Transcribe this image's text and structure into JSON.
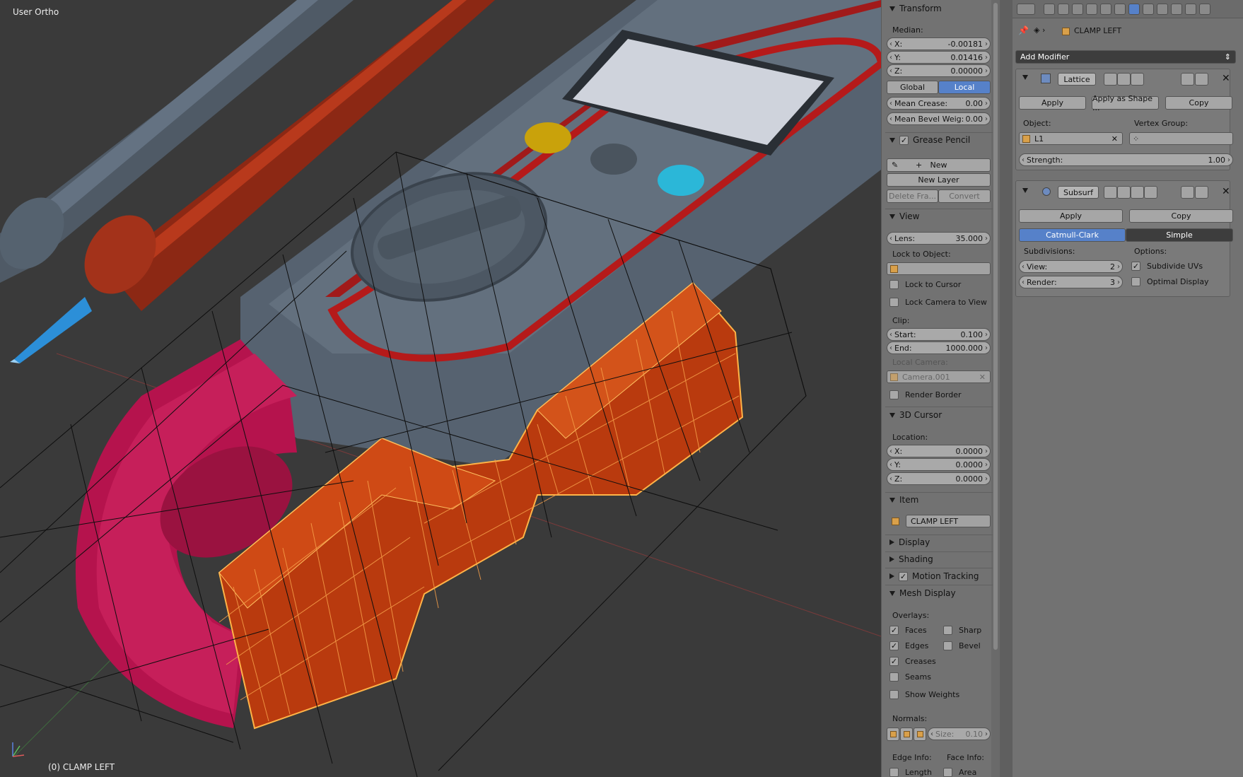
{
  "viewport": {
    "title": "User Ortho",
    "object_label": "(0) CLAMP LEFT"
  },
  "transform": {
    "header": "Transform",
    "median_label": "Median:",
    "x_label": "X:",
    "x": "-0.00181",
    "y_label": "Y:",
    "y": "0.01416",
    "z_label": "Z:",
    "z": "0.00000",
    "global": "Global",
    "local": "Local",
    "mean_crease_label": "Mean Crease:",
    "mean_crease": "0.00",
    "mean_bevel_label": "Mean Bevel Weig:",
    "mean_bevel": "0.00"
  },
  "grease_pencil": {
    "header": "Grease Pencil",
    "new": "New",
    "new_layer": "New Layer",
    "delete_frame": "Delete Fra...",
    "convert": "Convert"
  },
  "view": {
    "header": "View",
    "lens_label": "Lens:",
    "lens": "35.000",
    "lock_to_object": "Lock to Object:",
    "lock_to_cursor": "Lock to Cursor",
    "lock_camera": "Lock Camera to View",
    "clip": "Clip:",
    "start_label": "Start:",
    "start": "0.100",
    "end_label": "End:",
    "end": "1000.000",
    "local_camera": "Local Camera:",
    "camera_value": "Camera.001",
    "render_border": "Render Border"
  },
  "cursor": {
    "header": "3D Cursor",
    "location": "Location:",
    "x_label": "X:",
    "x": "0.0000",
    "y_label": "Y:",
    "y": "0.0000",
    "z_label": "Z:",
    "z": "0.0000"
  },
  "item": {
    "header": "Item",
    "name": "CLAMP LEFT"
  },
  "collapsed": {
    "display": "Display",
    "shading": "Shading",
    "motion_tracking": "Motion Tracking"
  },
  "mesh_display": {
    "header": "Mesh Display",
    "overlays": "Overlays:",
    "faces": "Faces",
    "sharp": "Sharp",
    "edges": "Edges",
    "bevel": "Bevel",
    "creases": "Creases",
    "seams": "Seams",
    "show_weights": "Show Weights",
    "normals": "Normals:",
    "size_label": "Size:",
    "size": "0.10",
    "edge_info": "Edge Info:",
    "face_info": "Face Info:",
    "length": "Length",
    "area": "Area"
  },
  "props": {
    "object_name": "CLAMP LEFT",
    "add_modifier": "Add Modifier",
    "lattice": {
      "name": "Lattice",
      "apply": "Apply",
      "apply_shape": "Apply as Shape ...",
      "copy": "Copy",
      "object_label": "Object:",
      "object_value": "L1",
      "vertex_group_label": "Vertex Group:",
      "strength_label": "Strength:",
      "strength": "1.00"
    },
    "subsurf": {
      "name": "Subsurf",
      "apply": "Apply",
      "copy": "Copy",
      "catmull": "Catmull-Clark",
      "simple": "Simple",
      "subdivisions": "Subdivisions:",
      "options": "Options:",
      "view_label": "View:",
      "view": "2",
      "render_label": "Render:",
      "render": "3",
      "subdivide_uvs": "Subdivide UVs",
      "optimal_display": "Optimal Display"
    }
  }
}
